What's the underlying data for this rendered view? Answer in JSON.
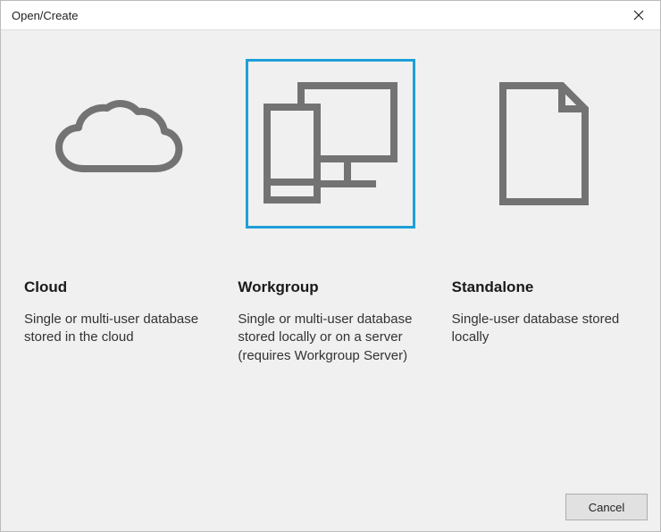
{
  "dialog": {
    "title": "Open/Create"
  },
  "options": {
    "cloud": {
      "title": "Cloud",
      "description": "Single or multi-user database stored in the cloud",
      "selected": false
    },
    "workgroup": {
      "title": "Workgroup",
      "description": "Single or multi-user database stored locally or on a server (requires Workgroup Server)",
      "selected": true
    },
    "standalone": {
      "title": "Standalone",
      "description": "Single-user database stored locally",
      "selected": false
    }
  },
  "buttons": {
    "cancel": "Cancel"
  },
  "colors": {
    "selection": "#1e9fd8",
    "iconStroke": "#737373",
    "panelBg": "#f0f0f0"
  }
}
